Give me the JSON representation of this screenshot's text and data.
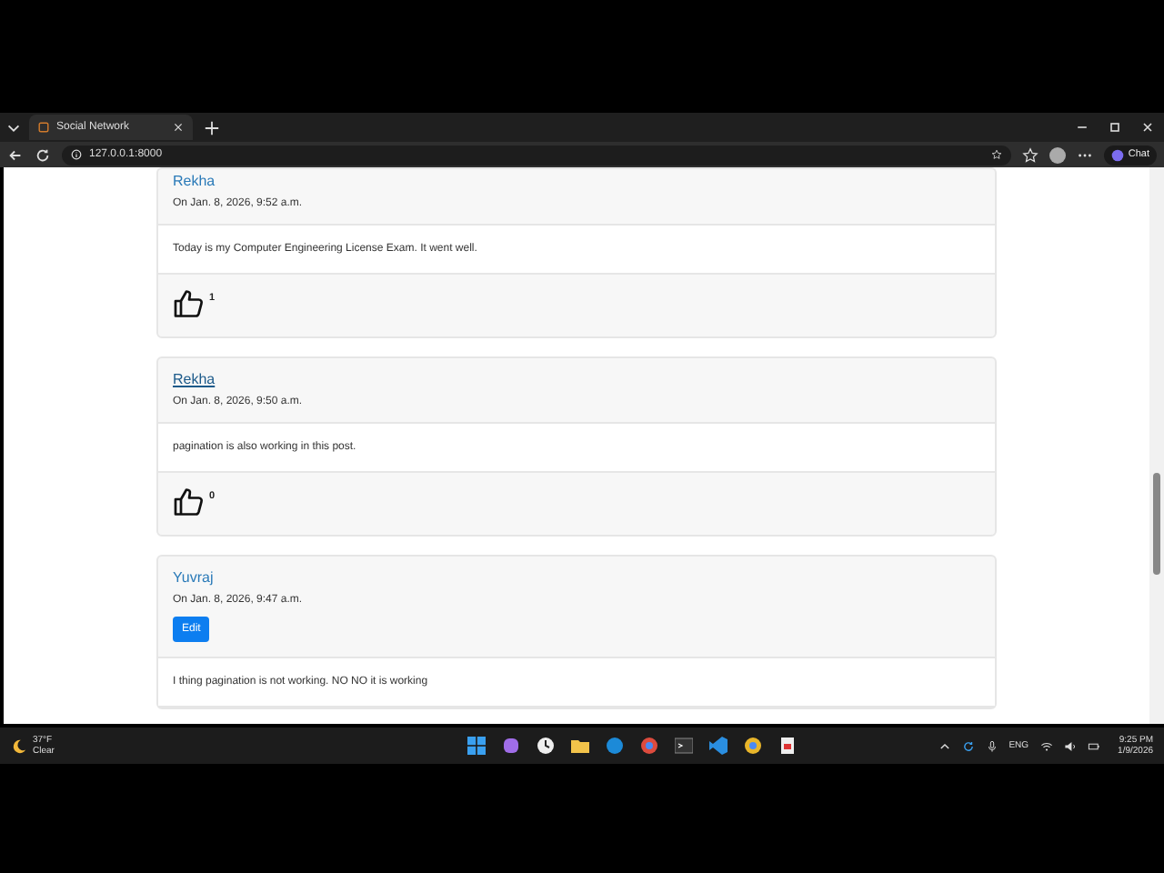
{
  "browser": {
    "tab_title": "Social Network",
    "url": "127.0.0.1:8000",
    "chat_button": "Chat"
  },
  "posts": [
    {
      "author": "Rekha",
      "hovered": false,
      "date": "On Jan. 8, 2026, 9:52 a.m.",
      "body": "Today is my Computer Engineering License Exam. It went well.",
      "likes": "1"
    },
    {
      "author": "Rekha",
      "hovered": true,
      "date": "On Jan. 8, 2026, 9:50 a.m.",
      "body": "pagination is also working in this post.",
      "likes": "0"
    },
    {
      "author": "Yuvraj",
      "hovered": false,
      "date": "On Jan. 8, 2026, 9:47 a.m.",
      "edit_button": "Edit",
      "body": "I thing pagination is not working. NO NO it is working"
    }
  ],
  "taskbar": {
    "temperature": "37°F",
    "weather": "Clear",
    "language": "ENG",
    "time": "9:25 PM",
    "date": "1/9/2026"
  }
}
